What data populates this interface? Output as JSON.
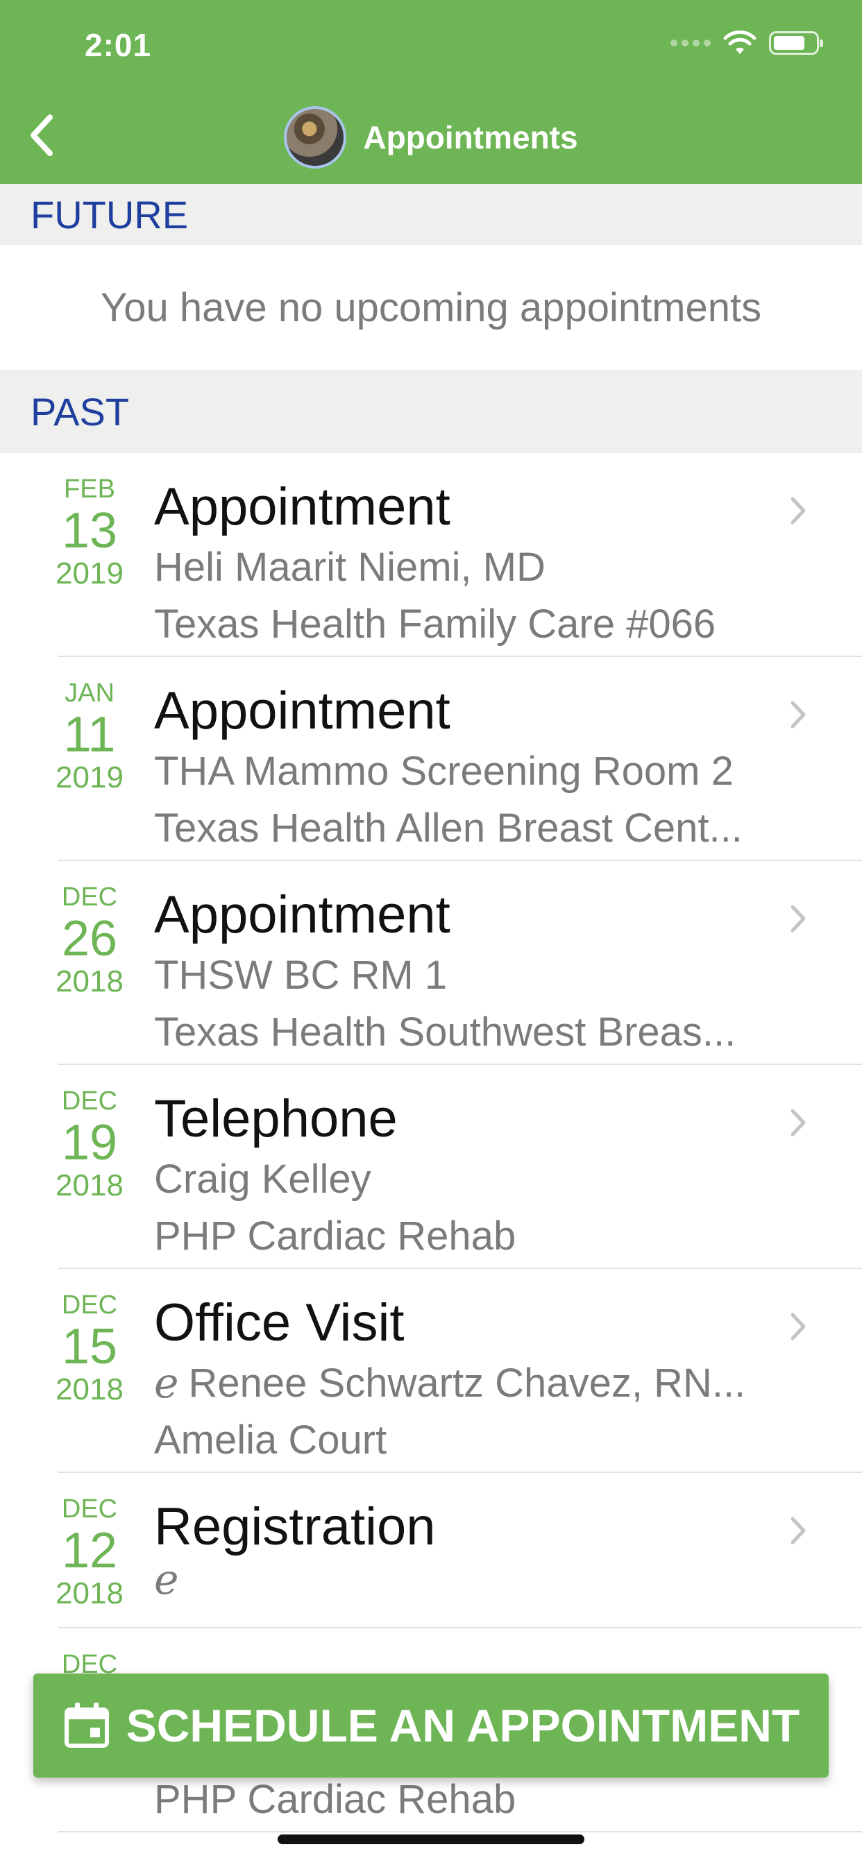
{
  "status_bar": {
    "time": "2:01"
  },
  "nav": {
    "title": "Appointments"
  },
  "sections": {
    "future": "FUTURE",
    "past": "PAST"
  },
  "future_empty": "You have no upcoming appointments",
  "appointments": [
    {
      "month": "FEB",
      "day": "13",
      "year": "2019",
      "type": "Appointment",
      "line1": "Heli Maarit Niemi, MD",
      "line2": "Texas Health Family Care #066"
    },
    {
      "month": "JAN",
      "day": "11",
      "year": "2019",
      "type": "Appointment",
      "line1": "THA Mammo Screening Room 2",
      "line2": "Texas Health Allen Breast Cent..."
    },
    {
      "month": "DEC",
      "day": "26",
      "year": "2018",
      "type": "Appointment",
      "line1": "THSW BC RM 1",
      "line2": "Texas Health Southwest Breas..."
    },
    {
      "month": "DEC",
      "day": "19",
      "year": "2018",
      "type": "Telephone",
      "line1": "Craig Kelley",
      "line2": "PHP Cardiac Rehab"
    },
    {
      "month": "DEC",
      "day": "15",
      "year": "2018",
      "type": "Office Visit",
      "line1": "Renee Schwartz Chavez, RN...",
      "line2": "Amelia Court"
    },
    {
      "month": "DEC",
      "day": "12",
      "year": "2018",
      "type": "Registration",
      "line1": "",
      "line2": ""
    },
    {
      "month": "DEC",
      "day": "",
      "year": "",
      "type": "",
      "line1": "",
      "line2": "PHP Cardiac Rehab"
    }
  ],
  "cta": {
    "label": "SCHEDULE AN APPOINTMENT"
  },
  "colors": {
    "header": "#6db555",
    "section_text": "#1f3f9e",
    "date_text": "#6db555"
  }
}
